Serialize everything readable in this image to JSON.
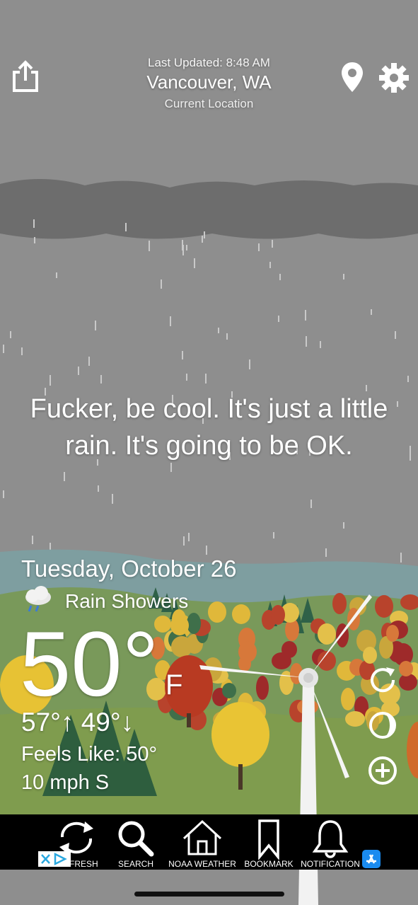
{
  "header": {
    "last_updated": "Last Updated: 8:48 AM",
    "city": "Vancouver, WA",
    "location_label": "Current Location",
    "share_icon": "share-icon",
    "location_icon": "location-pin-icon",
    "settings_icon": "gear-icon"
  },
  "message": {
    "text": "Fucker, be cool. It's just a little rain. It's going to be OK."
  },
  "weather": {
    "date": "Tuesday, October 26",
    "condition": "Rain Showers",
    "condition_icon": "rain-cloud-icon",
    "temperature": "50°",
    "unit": "F",
    "hi_lo": "57°↑ 49°↓",
    "feels_like": "Feels Like: 50°",
    "wind": "10 mph S"
  },
  "side_actions": {
    "refresh_icon": "refresh-icon",
    "moon_icon": "moon-phase-icon",
    "add_icon": "add-circle-icon"
  },
  "tabbar": {
    "items": [
      {
        "label": "FRESH",
        "icon": "refresh-arrows-icon"
      },
      {
        "label": "SEARCH",
        "icon": "search-icon"
      },
      {
        "label": "NOAA WEATHER",
        "icon": "house-icon"
      },
      {
        "label": "BOOKMARK",
        "icon": "bookmark-icon"
      },
      {
        "label": "NOTIFICATION",
        "icon": "bell-icon"
      }
    ]
  },
  "colors": {
    "sky": "#8e8e8e",
    "cloud": "#6f6f6f",
    "mountain": "#7d9aa0",
    "hill": "#7a9a55",
    "tabbar": "#000000"
  }
}
